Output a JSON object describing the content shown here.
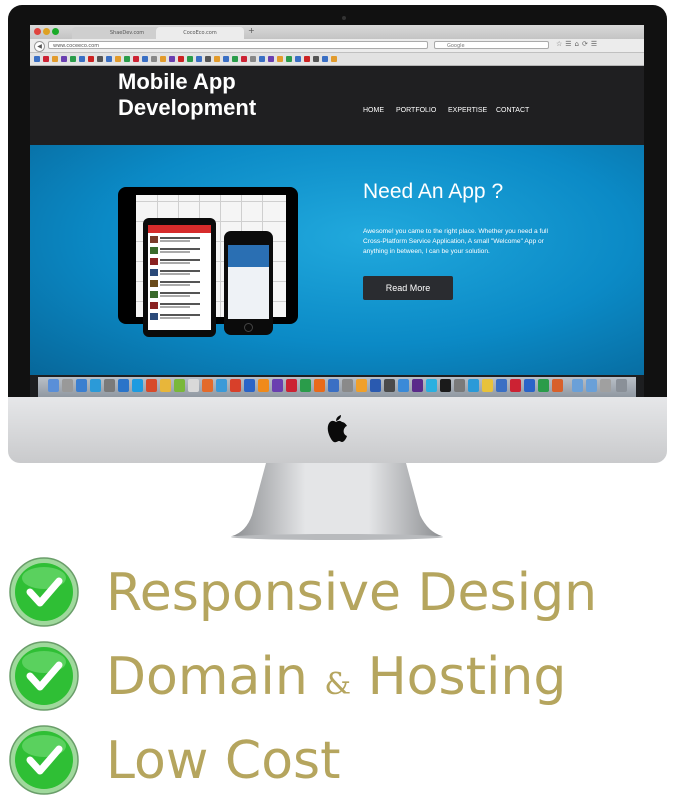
{
  "browser": {
    "tabs": [
      "ShaeDev.com",
      "CocoEco.com"
    ],
    "url": "www.coceeco.com",
    "search_placeholder": "Google"
  },
  "site": {
    "title_line1": "Mobile App",
    "title_line2": "Development",
    "nav": [
      "HOME",
      "PORTFOLIO",
      "EXPERTISE",
      "CONTACT"
    ],
    "hero_heading": "Need An App ?",
    "hero_body": "Awesome! you came to the right place. Whether you need a full Cross-Platform Service Application, A small \"Welcome\" App or anything in between, I can be your solution.",
    "hero_button": "Read More"
  },
  "features": {
    "item1": "Responsive Design",
    "item2_a": "Domain",
    "item2_amp": "&",
    "item2_b": "Hosting",
    "item3": "Low Cost"
  },
  "colors": {
    "feature_text": "#b5a55e",
    "hero_blue": "#0b8ac6",
    "header_dark": "#1f1f21",
    "check_green": "#2fbf35"
  },
  "icons": [
    "apple-logo-icon",
    "check-circle-icon"
  ]
}
